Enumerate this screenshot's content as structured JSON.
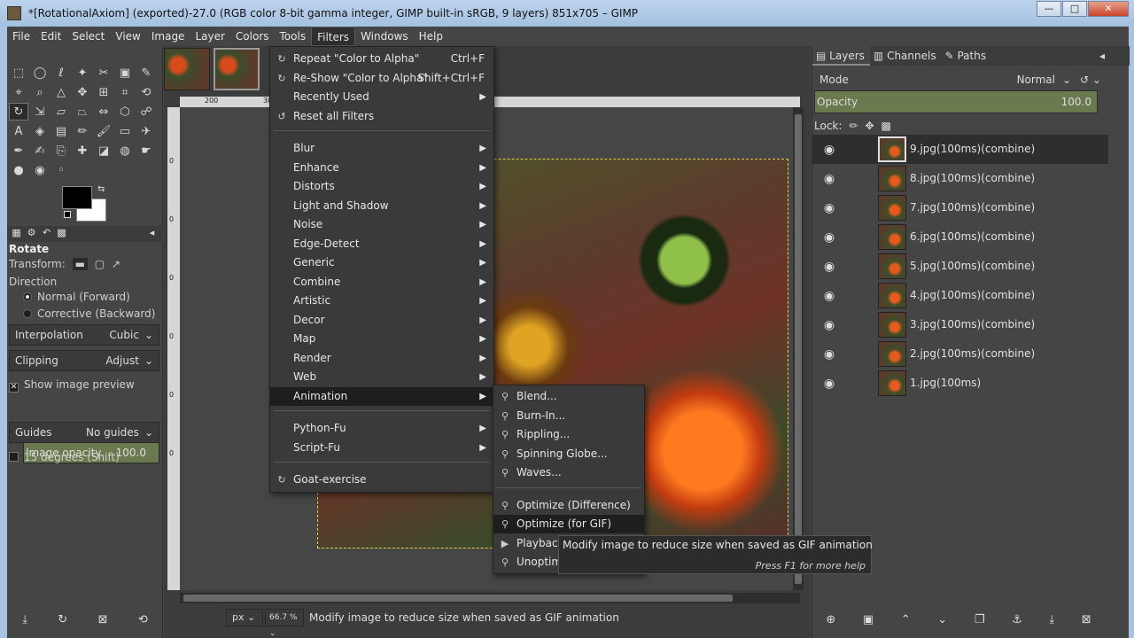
{
  "window": {
    "title": "*[RotationalAxiom] (exported)-27.0 (RGB color 8-bit gamma integer, GIMP built-in sRGB, 9 layers) 851x705 – GIMP",
    "minimize": "—",
    "maximize": "□",
    "close": "✕"
  },
  "menubar": [
    "File",
    "Edit",
    "Select",
    "View",
    "Image",
    "Layer",
    "Colors",
    "Tools",
    "Filters",
    "Windows",
    "Help"
  ],
  "tool_options": {
    "title": "Rotate",
    "transform_label": "Transform:",
    "direction_label": "Direction",
    "direction_options": [
      "Normal (Forward)",
      "Corrective (Backward)"
    ],
    "interpolation_label": "Interpolation",
    "interpolation_value": "Cubic",
    "clipping_label": "Clipping",
    "clipping_value": "Adjust",
    "show_preview": "Show image preview",
    "image_opacity_label": "Image opacity",
    "image_opacity_value": "100.0",
    "guides_label": "Guides",
    "guides_value": "No guides",
    "degrees_label": "15 degrees (Shift)"
  },
  "ruler": {
    "h_marks": [
      "200",
      "300"
    ],
    "v_marks": [
      "0",
      "0",
      "0",
      "0",
      "0",
      "0"
    ]
  },
  "statusbar": {
    "unit": "px",
    "zoom": "66.7 %",
    "message": "Modify image to reduce size when saved as GIF animation"
  },
  "filters_menu": {
    "items": [
      {
        "label": "Repeat \"Color to Alpha\"",
        "shortcut": "Ctrl+F",
        "icon": "repeat-icon"
      },
      {
        "label": "Re-Show \"Color to Alpha\"",
        "shortcut": "Shift+Ctrl+F",
        "icon": "reshow-icon"
      },
      {
        "label": "Recently Used"
      },
      {
        "label": "Reset all Filters",
        "icon": "reset-icon"
      },
      {
        "label": "Blur"
      },
      {
        "label": "Enhance"
      },
      {
        "label": "Distorts"
      },
      {
        "label": "Light and Shadow"
      },
      {
        "label": "Noise"
      },
      {
        "label": "Edge-Detect"
      },
      {
        "label": "Generic"
      },
      {
        "label": "Combine"
      },
      {
        "label": "Artistic"
      },
      {
        "label": "Decor"
      },
      {
        "label": "Map"
      },
      {
        "label": "Render"
      },
      {
        "label": "Web"
      },
      {
        "label": "Animation"
      },
      {
        "label": "Python-Fu"
      },
      {
        "label": "Script-Fu"
      },
      {
        "label": "Goat-exercise",
        "icon": "goat-icon"
      }
    ]
  },
  "animation_menu": {
    "items": [
      "Blend...",
      "Burn-In...",
      "Rippling...",
      "Spinning Globe...",
      "Waves...",
      "Optimize (Difference)",
      "Optimize (for GIF)",
      "Playback...",
      "Unoptimize"
    ]
  },
  "tooltip": {
    "text": "Modify image to reduce size when saved as GIF animation",
    "help": "Press F1 for more help"
  },
  "layers_dock": {
    "tabs": [
      "Layers",
      "Channels",
      "Paths"
    ],
    "mode_label": "Mode",
    "mode_value": "Normal",
    "opacity_label": "Opacity",
    "opacity_value": "100.0",
    "lock_label": "Lock:",
    "layers": [
      "9.jpg(100ms)(combine)",
      "8.jpg(100ms)(combine)",
      "7.jpg(100ms)(combine)",
      "6.jpg(100ms)(combine)",
      "5.jpg(100ms)(combine)",
      "4.jpg(100ms)(combine)",
      "3.jpg(100ms)(combine)",
      "2.jpg(100ms)(combine)",
      "1.jpg(100ms)"
    ]
  }
}
